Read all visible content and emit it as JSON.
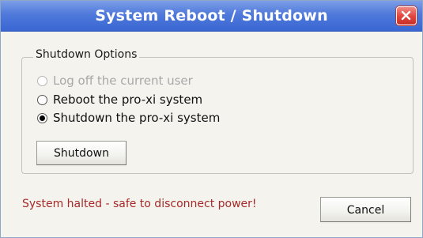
{
  "window": {
    "title": "System Reboot / Shutdown",
    "close_icon": "close-icon"
  },
  "options_group": {
    "legend": "Shutdown Options",
    "options": [
      {
        "label": "Log off the current user",
        "selected": false,
        "enabled": false
      },
      {
        "label": "Reboot the pro-xi system",
        "selected": false,
        "enabled": true
      },
      {
        "label": "Shutdown the pro-xi system",
        "selected": true,
        "enabled": true
      }
    ]
  },
  "actions": {
    "shutdown_label": "Shutdown",
    "cancel_label": "Cancel"
  },
  "status": {
    "message": "System halted - safe to disconnect power!",
    "color": "#a52a2a"
  },
  "colors": {
    "titlebar": "#4f79db",
    "close_button": "#e0443c"
  }
}
